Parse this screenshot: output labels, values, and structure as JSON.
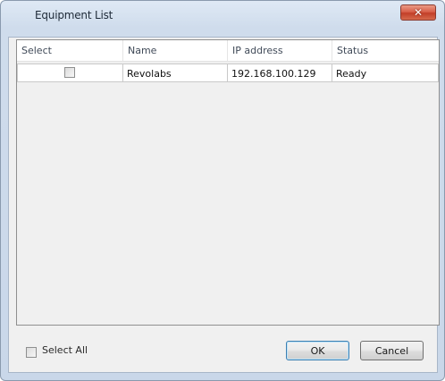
{
  "window": {
    "title": "Equipment List",
    "close_label": "✕"
  },
  "table": {
    "columns": [
      "Select",
      "Name",
      "IP address",
      "Status"
    ],
    "rows": [
      {
        "selected": false,
        "name": "Revolabs",
        "ip": "192.168.100.129",
        "status": "Ready"
      }
    ]
  },
  "footer": {
    "select_all_label": "Select All",
    "select_all_checked": false,
    "ok_label": "OK",
    "cancel_label": "Cancel"
  }
}
